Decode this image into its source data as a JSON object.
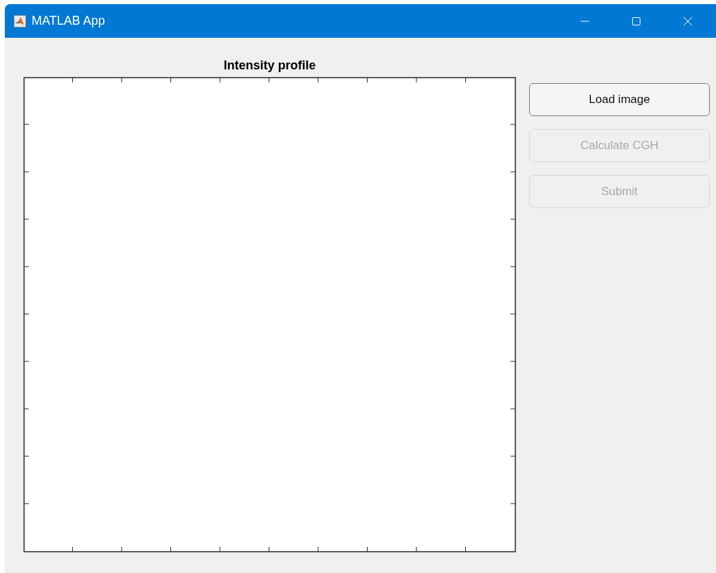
{
  "window": {
    "title": "MATLAB App"
  },
  "axes": {
    "title": "Intensity profile"
  },
  "buttons": [
    {
      "label": "Load image",
      "disabled": false
    },
    {
      "label": "Calculate CGH",
      "disabled": true
    },
    {
      "label": "Submit",
      "disabled": true
    }
  ]
}
